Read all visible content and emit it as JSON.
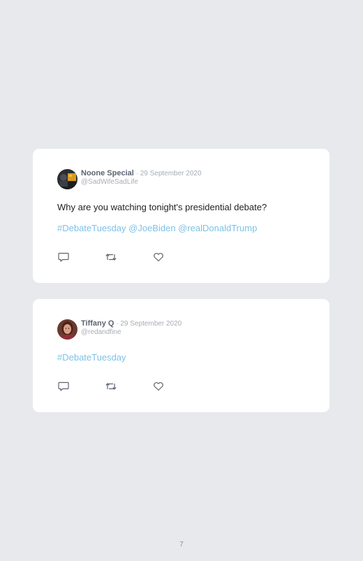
{
  "tweets": [
    {
      "name": "Noone Special",
      "separator": " · ",
      "date": "29 September 2020",
      "handle": "@SadWifeSadLife",
      "text": "Why are you watching tonight's presidential debate?",
      "hashtags": "#DebateTuesday @JoeBiden @realDonaldTrump",
      "avatar_icon": "profile-photo"
    },
    {
      "name": "Tiffany Q",
      "separator": " · ",
      "date": "29 September 2020",
      "handle": "@redandfine",
      "text": "",
      "hashtags": "#DebateTuesday",
      "avatar_icon": "profile-photo"
    }
  ],
  "actions": {
    "reply_icon": "comment-icon",
    "retweet_icon": "retweet-icon",
    "like_icon": "heart-icon"
  },
  "colors": {
    "background": "#e8e9ec",
    "card": "#ffffff",
    "link": "#7cc2e6",
    "name": "#5b6470",
    "muted": "#a7adb5"
  },
  "page_number": "7"
}
